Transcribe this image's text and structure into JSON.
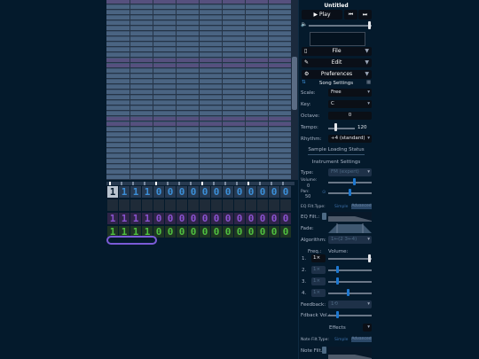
{
  "app": {
    "title": "Untitled"
  },
  "transport": {
    "play_label": "Play",
    "play_glyph": "▶",
    "prev_glyph": "⏮",
    "next_glyph": "⏭",
    "volume_glyph": "🔈",
    "volume_level": 0.98
  },
  "menus": {
    "file": "File",
    "edit": "Edit",
    "preferences": "Preferences"
  },
  "song": {
    "header": "Song Settings",
    "scale_label": "Scale:",
    "scale_value": "Free",
    "key_label": "Key:",
    "key_value": "C",
    "octave_label": "Octave:",
    "octave_value": "0",
    "tempo_label": "Tempo:",
    "tempo_value": "120",
    "rhythm_label": "Rhythm:",
    "rhythm_value": "÷4 (standard)"
  },
  "sample_status": "Sample Loading Status",
  "instrument": {
    "header": "Instrument Settings",
    "type_label": "Type:",
    "type_value": "FM (expert)",
    "volume_label": "Volume:",
    "volume_value": "0",
    "volume_level": 0.6,
    "pan_label": "Pan:",
    "pan_value": "50",
    "pan_level": 0.5,
    "eq_type_label": "EQ Filt.Type:",
    "eq_simple": "Simple",
    "eq_advanced": "Advanced",
    "eq_filt_label": "EQ Filt.:",
    "fade_label": "Fade:",
    "algorithm_label": "Algorithm:",
    "algorithm_value": "1←(2 3←4)",
    "freq_label": "Freq.:",
    "op_volume_label": "Volume:",
    "operators": [
      {
        "name": "1.",
        "freq": "1×",
        "level": 0.97
      },
      {
        "name": "2.",
        "freq": "1×",
        "level": 0.2
      },
      {
        "name": "3.",
        "freq": "1×",
        "level": 0.2
      },
      {
        "name": "4.",
        "freq": "1×",
        "level": 0.45
      }
    ],
    "feedback_label": "Feedback:",
    "feedback_value": "1⟲",
    "fdbk_vol_label": "Fdback Vol.:",
    "fdbk_vol_level": 0.2,
    "effects_label": "Effects",
    "note_filt_type_label": "Note Filt.Type:",
    "note_filt_simple": "Simple",
    "note_filt_advanced": "Advanced",
    "note_filt_label": "Note Filt.:"
  },
  "pattern": {
    "rows": [
      {
        "color": "#3b8fd8",
        "dim": "#263a52",
        "values": [
          "1",
          "1",
          "1",
          "1",
          "0",
          "0",
          "0",
          "0",
          "0",
          "0",
          "0",
          "0",
          "0",
          "0",
          "0",
          "0"
        ]
      },
      {
        "color": "#c2c2c2",
        "dim": "#1f2b38",
        "values": [
          "",
          "",
          "",
          "",
          "",
          "",
          "",
          "",
          "",
          "",
          "",
          "",
          "",
          "",
          "",
          ""
        ]
      },
      {
        "color": "#8a52d1",
        "dim": "#2e2447",
        "values": [
          "1",
          "1",
          "1",
          "1",
          "0",
          "0",
          "0",
          "0",
          "0",
          "0",
          "0",
          "0",
          "0",
          "0",
          "0",
          "0"
        ]
      },
      {
        "color": "#4fbf3f",
        "dim": "#1e3524",
        "values": [
          "1",
          "1",
          "1",
          "1",
          "0",
          "0",
          "0",
          "0",
          "0",
          "0",
          "0",
          "0",
          "0",
          "0",
          "0",
          "0"
        ]
      }
    ],
    "selected_value": "1"
  }
}
